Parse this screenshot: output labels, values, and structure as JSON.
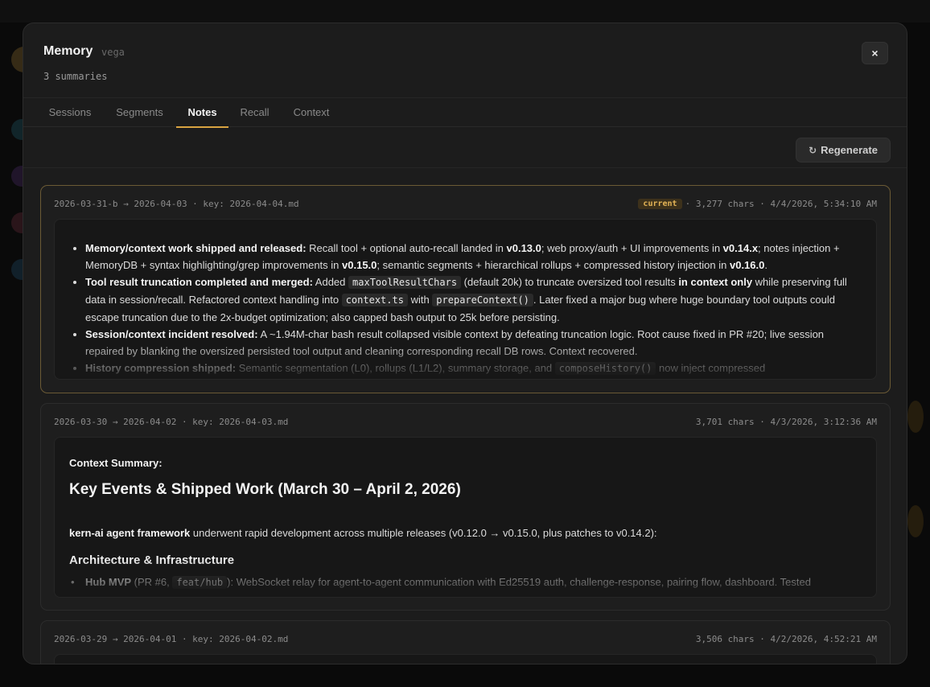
{
  "modal": {
    "title": "Memory",
    "agent": "vega",
    "summary_count": "3 summaries",
    "close_glyph": "×"
  },
  "tabs": [
    {
      "label": "Sessions",
      "active": false
    },
    {
      "label": "Segments",
      "active": false
    },
    {
      "label": "Notes",
      "active": true
    },
    {
      "label": "Recall",
      "active": false
    },
    {
      "label": "Context",
      "active": false
    }
  ],
  "toolbar": {
    "regenerate_label": "Regenerate",
    "regenerate_icon": "refresh-icon"
  },
  "colors": {
    "accent": "#d9a441",
    "current_border": "#6b5a35",
    "badge_bg": "#3d311b",
    "badge_text": "#e3b356"
  },
  "notes": [
    {
      "meta": "2026-03-31-b → 2026-04-03 · key: 2026-04-04.md",
      "badge": "current",
      "info": "· 3,277 chars · 4/4/2026, 5:34:10 AM",
      "bullets": [
        {
          "lead": "Memory/context work shipped and released:",
          "t1": " Recall tool + optional auto-recall landed in ",
          "v1": "v0.13.0",
          "t2": "; web proxy/auth + UI improvements in ",
          "v2": "v0.14.x",
          "t3": "; notes injection + MemoryDB + syntax highlighting/grep improvements in ",
          "v3": "v0.15.0",
          "t4": "; semantic segments + hierarchical rollups + compressed history injection in ",
          "v4": "v0.16.0",
          "t5": "."
        },
        {
          "lead": "Tool result truncation completed and merged:",
          "t1": " Added ",
          "c1": "maxToolResultChars",
          "t2": " (default 20k) to truncate oversized tool results ",
          "b1": "in context only",
          "t3": " while preserving full data in session/recall. Refactored context handling into ",
          "c2": "context.ts",
          "t4": " with ",
          "c3": "prepareContext()",
          "t5": ". Later fixed a major bug where huge boundary tool outputs could escape truncation due to the 2x-budget optimization; also capped bash output to 25k before persisting."
        },
        {
          "lead": "Session/context incident resolved:",
          "t1": " A ~1.94M-char bash result collapsed visible context by defeating truncation logic. Root cause fixed in PR #20; live session repaired by blanking the oversized persisted tool output and cleaning corresponding recall DB rows. Context recovered."
        },
        {
          "lead": "History compression shipped:",
          "t1": " Semantic segmentation (L0), rollups (L1/L2), summary storage, and ",
          "c1": "composeHistory()",
          "t2": " now inject compressed"
        }
      ]
    },
    {
      "meta": "2026-03-30 → 2026-04-02 · key: 2026-04-03.md",
      "info": "3,701 chars · 4/3/2026, 3:12:36 AM",
      "label": "Context Summary:",
      "heading": "Key Events & Shipped Work (March 30 – April 2, 2026)",
      "para_bold": "kern-ai agent framework",
      "para_rest": " underwent rapid development across multiple releases (v0.12.0 → v0.15.0, plus patches to v0.14.2):",
      "subheading": "Architecture & Infrastructure",
      "item_bold": "Hub MVP",
      "item_t1": " (PR #6, ",
      "item_code": "feat/hub",
      "item_t2": "): WebSocket relay for agent-to-agent communication with Ed25519 auth, challenge-response, pairing flow, dashboard. Tested"
    },
    {
      "meta": "2026-03-29 → 2026-04-01 · key: 2026-04-02.md",
      "info": "3,506 chars · 4/2/2026, 4:52:21 AM"
    }
  ]
}
